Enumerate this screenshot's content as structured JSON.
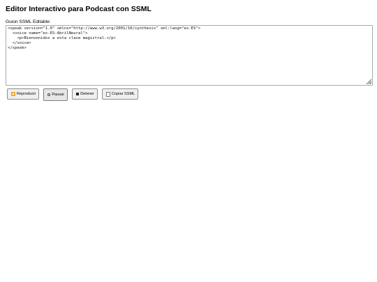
{
  "page": {
    "title": "Editor Interactivo para Podcast con SSML"
  },
  "editor": {
    "label": "Guion SSML Editable:",
    "content": "<speak version=\"1.0\" xmlns=\"http://www.w3.org/2001/10/synthesis\" xml:lang=\"es-ES\">\n  <voice name=\"es-ES-AbrilNeural\">\n    <p>Bienvenidos a esta clase magistral.</p>\n  </voice>\n</speak>"
  },
  "controls": {
    "play_label": "Reproducir",
    "pause_label": "Pausar",
    "stop_label": "Detener",
    "copy_label": "Copiar SSML"
  },
  "icons": {
    "play": "play-icon",
    "pause": "pause-icon",
    "stop": "stop-icon",
    "copy": "copy-icon"
  },
  "colors": {
    "play_icon": "#f0a020",
    "button_bg": "#efefef",
    "border": "#a9a9a9"
  }
}
